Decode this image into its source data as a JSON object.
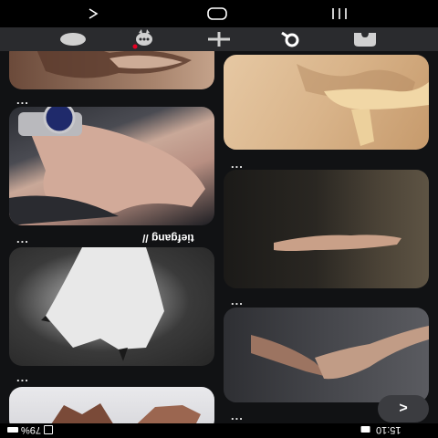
{
  "status_bar": {
    "time": "15:10",
    "battery": "79%"
  },
  "feed": {
    "more_label": "...",
    "tag_text": "tiefgang //",
    "fab_label": ">"
  },
  "icons": {
    "back": "back-icon",
    "home": "home-icon",
    "recents": "recents-icon",
    "toolbar_home": "home-icon",
    "chat": "chat-icon",
    "add": "add-icon",
    "search": "search-icon",
    "profile": "profile-icon"
  }
}
